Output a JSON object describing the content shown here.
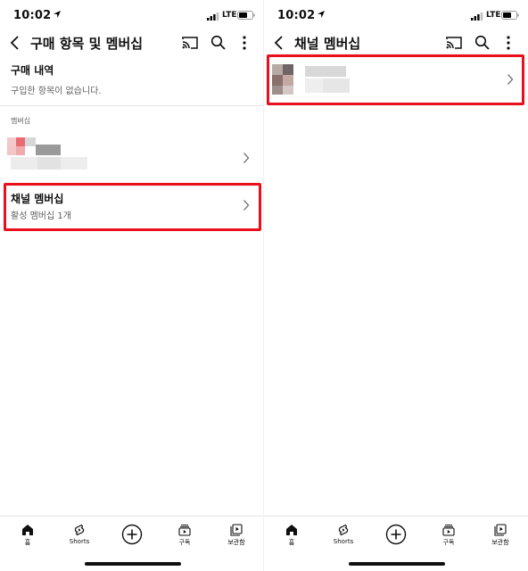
{
  "status": {
    "time": "10:02",
    "network": "LTE"
  },
  "left": {
    "title": "구매 항목 및 멤버십",
    "purchase": {
      "title": "구매 내역",
      "subtitle": "구입한 항목이 없습니다."
    },
    "section_label": "멤버십",
    "channel_membership": {
      "title": "채널 멤버십",
      "subtitle": "활성 멤버십 1개"
    }
  },
  "right": {
    "title": "채널 멤버십"
  },
  "bottom_nav": [
    {
      "label": "홈",
      "icon": "home-icon"
    },
    {
      "label": "Shorts",
      "icon": "shorts-icon"
    },
    {
      "label": "",
      "icon": "create-plus-icon"
    },
    {
      "label": "구독",
      "icon": "subscriptions-icon"
    },
    {
      "label": "보관함",
      "icon": "library-icon"
    }
  ],
  "colors": {
    "highlight": "#e8101a",
    "text": "#0f0f0f",
    "muted": "#606060"
  }
}
